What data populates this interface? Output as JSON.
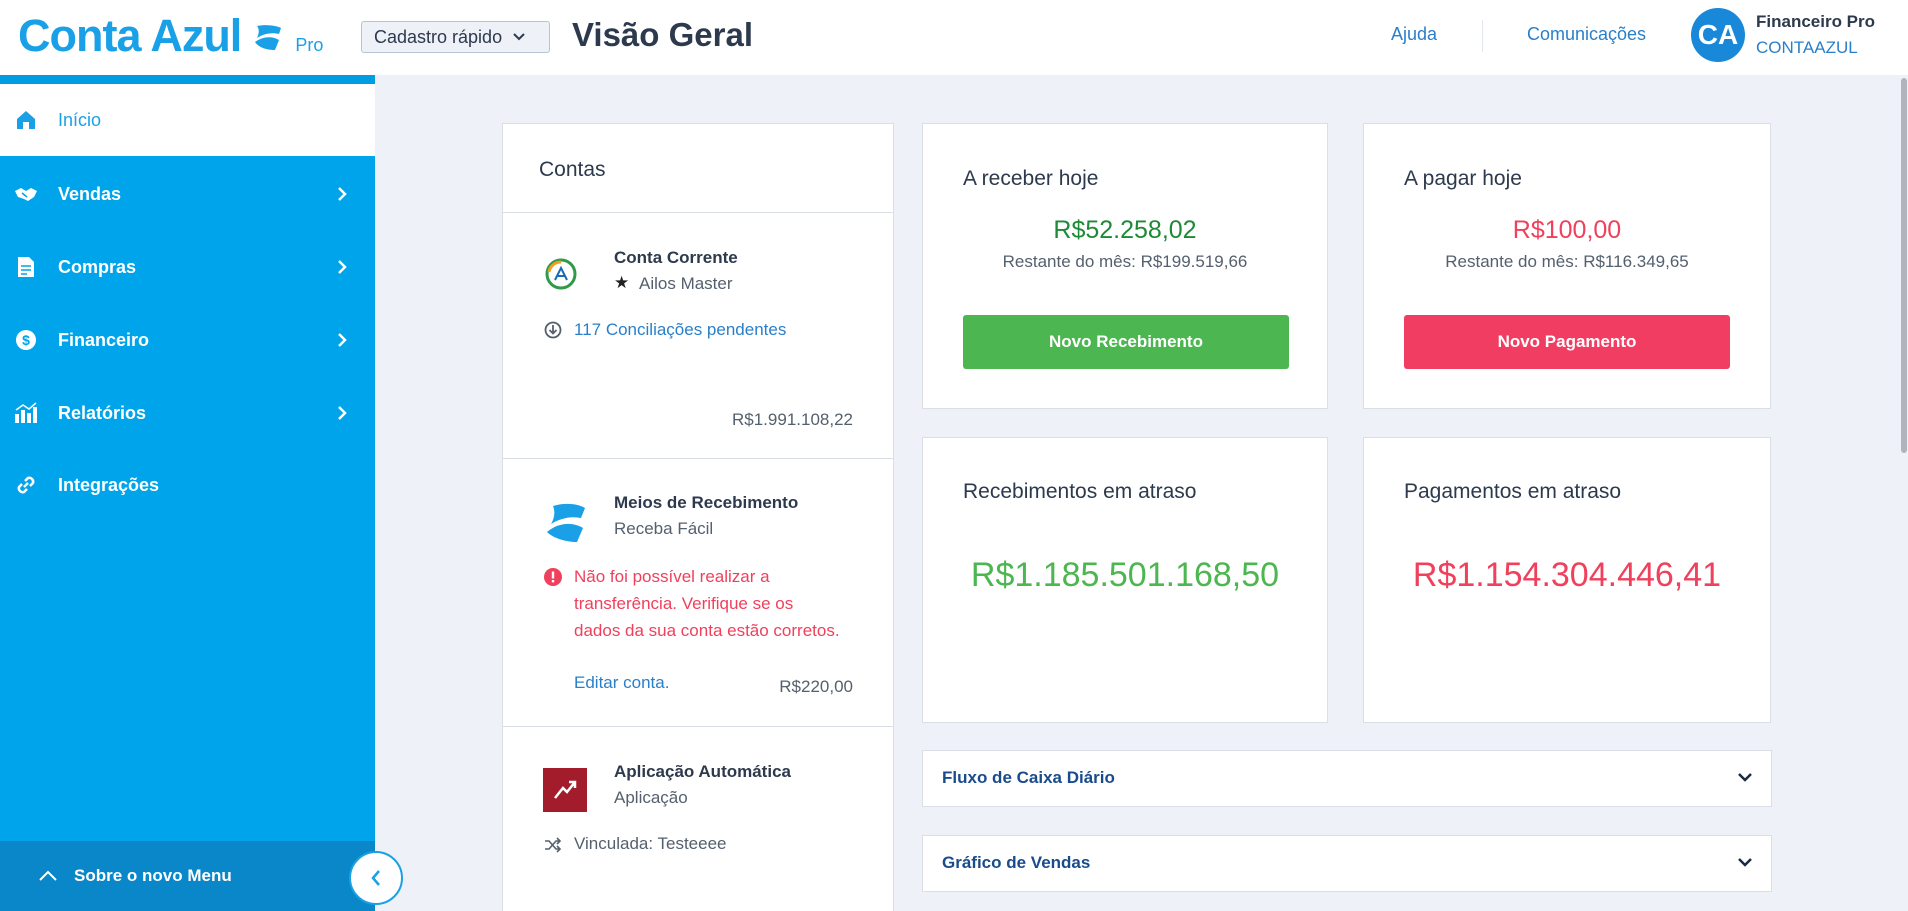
{
  "header": {
    "logo_text": "Conta Azul",
    "logo_suffix": "Pro",
    "quick_register_label": "Cadastro rápido",
    "page_title": "Visão Geral",
    "help_link": "Ajuda",
    "communications_link": "Comunicações",
    "avatar_initials": "CA",
    "user_name": "Financeiro Pro",
    "company_name": "CONTAAZUL"
  },
  "sidebar": {
    "items": [
      {
        "label": "Início",
        "icon": "home-icon",
        "active": true
      },
      {
        "label": "Vendas",
        "icon": "handshake-icon"
      },
      {
        "label": "Compras",
        "icon": "document-icon"
      },
      {
        "label": "Financeiro",
        "icon": "dollar-icon"
      },
      {
        "label": "Relatórios",
        "icon": "chart-icon"
      },
      {
        "label": "Integrações",
        "icon": "link-icon"
      }
    ],
    "bottom_label": "Sobre o novo Menu"
  },
  "contas": {
    "title": "Contas",
    "accounts": [
      {
        "name": "Conta Corrente",
        "bank": "Ailos Master",
        "pending_link": "117 Conciliações pendentes",
        "balance": "R$1.991.108,22"
      },
      {
        "name": "Meios de Recebimento",
        "type": "Receba Fácil",
        "error": "Não foi possível realizar a transferência. Verifique se os dados da sua conta estão corretos.",
        "edit_link": "Editar conta.",
        "balance": "R$220,00"
      },
      {
        "name": "Aplicação Automática",
        "type": "Aplicação",
        "linked": "Vinculada: Testeeee"
      }
    ]
  },
  "receber_hoje": {
    "title": "A receber hoje",
    "value": "R$52.258,02",
    "rest": "Restante do mês: R$199.519,66",
    "button": "Novo Recebimento"
  },
  "pagar_hoje": {
    "title": "A pagar hoje",
    "value": "R$100,00",
    "rest": "Restante do mês: R$116.349,65",
    "button": "Novo Pagamento"
  },
  "recebimentos_atraso": {
    "title": "Recebimentos em atraso",
    "value": "R$1.185.501.168,50"
  },
  "pagamentos_atraso": {
    "title": "Pagamentos em atraso",
    "value": "R$1.154.304.446,41"
  },
  "panels": {
    "fluxo_caixa": "Fluxo de Caixa Diário",
    "grafico_vendas": "Gráfico de Vendas"
  },
  "colors": {
    "brand_blue": "#00a4ea",
    "link_blue": "#2a7fc9",
    "green_button": "#4cb650",
    "red_button": "#f23d62",
    "positive_green": "#1d8a35",
    "negative_red": "#f0405c"
  }
}
